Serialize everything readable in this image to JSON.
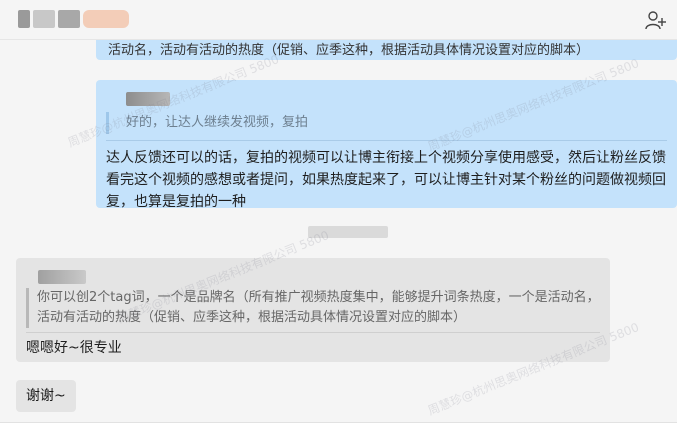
{
  "header": {
    "add_user_icon": "add-user-icon"
  },
  "messages": {
    "top_partial": "活动名，活动有活动的热度（促销、应季这种，根据活动具体情况设置对应的脚本）",
    "right": {
      "quote_text": "好的，让达人继续发视频，复拍",
      "body": "达人反馈还可以的话，复拍的视频可以让博主衔接上个视频分享使用感受，然后让粉丝反馈看完这个视频的感想或者提问，如果热度起来了，可以让博主针对某个粉丝的问题做视频回复，也算是复拍的一种"
    },
    "left": {
      "quote_text": "你可以创2个tag词，一个是品牌名（所有推广视频热度集中，能够提升词条热度，一个是活动名，活动有活动的热度（促销、应季这种，根据活动具体情况设置对应的脚本）",
      "body": "嗯嗯好~很专业"
    },
    "left_2": {
      "body": "谢谢~"
    }
  },
  "watermark": {
    "text": "周慧珍@杭州思奥网络科技有限公司 5800"
  },
  "colors": {
    "bubble_blue": "#c4e2fb",
    "bubble_gray": "#e4e4e4"
  }
}
